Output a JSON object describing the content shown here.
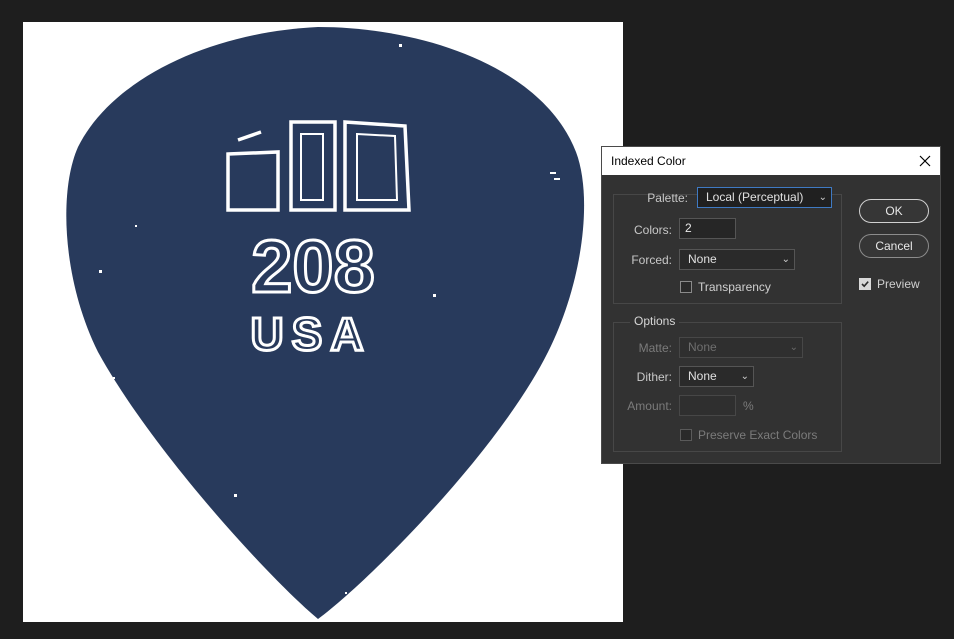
{
  "document": {
    "pick_top_label": "",
    "pick_number": "208",
    "pick_country": "USA",
    "pick_color": "#283a5c"
  },
  "dialog": {
    "title": "Indexed Color",
    "close_icon": "close-icon",
    "palette_label": "Palette:",
    "palette_value": "Local (Perceptual)",
    "colors_label": "Colors:",
    "colors_value": "2",
    "forced_label": "Forced:",
    "forced_value": "None",
    "transparency_label": "Transparency",
    "transparency_checked": false,
    "options_legend": "Options",
    "matte_label": "Matte:",
    "matte_value": "None",
    "dither_label": "Dither:",
    "dither_value": "None",
    "amount_label": "Amount:",
    "amount_value": "",
    "amount_unit": "%",
    "preserve_label": "Preserve Exact Colors",
    "ok_label": "OK",
    "cancel_label": "Cancel",
    "preview_label": "Preview",
    "preview_checked": true
  }
}
